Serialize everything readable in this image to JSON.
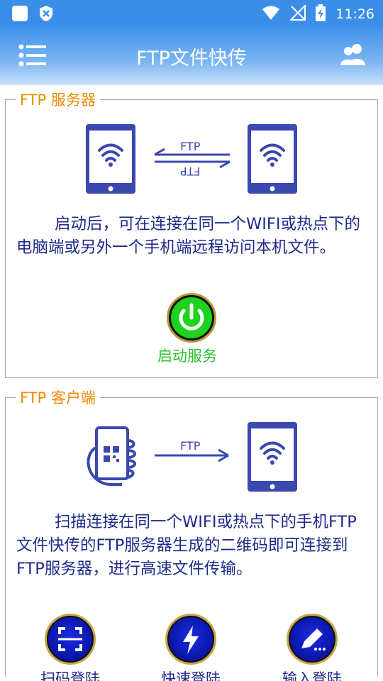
{
  "status_bar": {
    "time": "11:26",
    "icons": [
      "square-icon",
      "shield-icon",
      "wifi-icon",
      "no-signal-icon",
      "battery-charging-icon"
    ]
  },
  "app_bar": {
    "title": "FTP文件快传",
    "menu_icon": "menu-icon",
    "users_icon": "users-icon"
  },
  "server": {
    "title": "FTP 服务器",
    "arrow_top_label": "FTP",
    "arrow_bottom_label": "FTP",
    "description": "启动后，可在连接在同一个WIFI或热点下的电脑端或另外一个手机端远程访问本机文件。",
    "start_label": "启动服务"
  },
  "client": {
    "title": "FTP 客户端",
    "arrow_label": "FTP",
    "description": "扫描连接在同一个WIFI或热点下的手机FTP文件快传的FTP服务器生成的二维码即可连接到FTP服务器，进行高速文件传输。",
    "buttons": [
      {
        "label": "扫码登陆",
        "icon": "scan-icon"
      },
      {
        "label": "快速登陆",
        "icon": "lightning-icon"
      },
      {
        "label": "输入登陆",
        "icon": "pencil-icon"
      }
    ]
  },
  "colors": {
    "status_bar": "#3b8ee8",
    "section_title": "#f08a00",
    "text": "#1e2a8a",
    "start_label": "#27c22a",
    "device_blue": "#3a48b0"
  }
}
